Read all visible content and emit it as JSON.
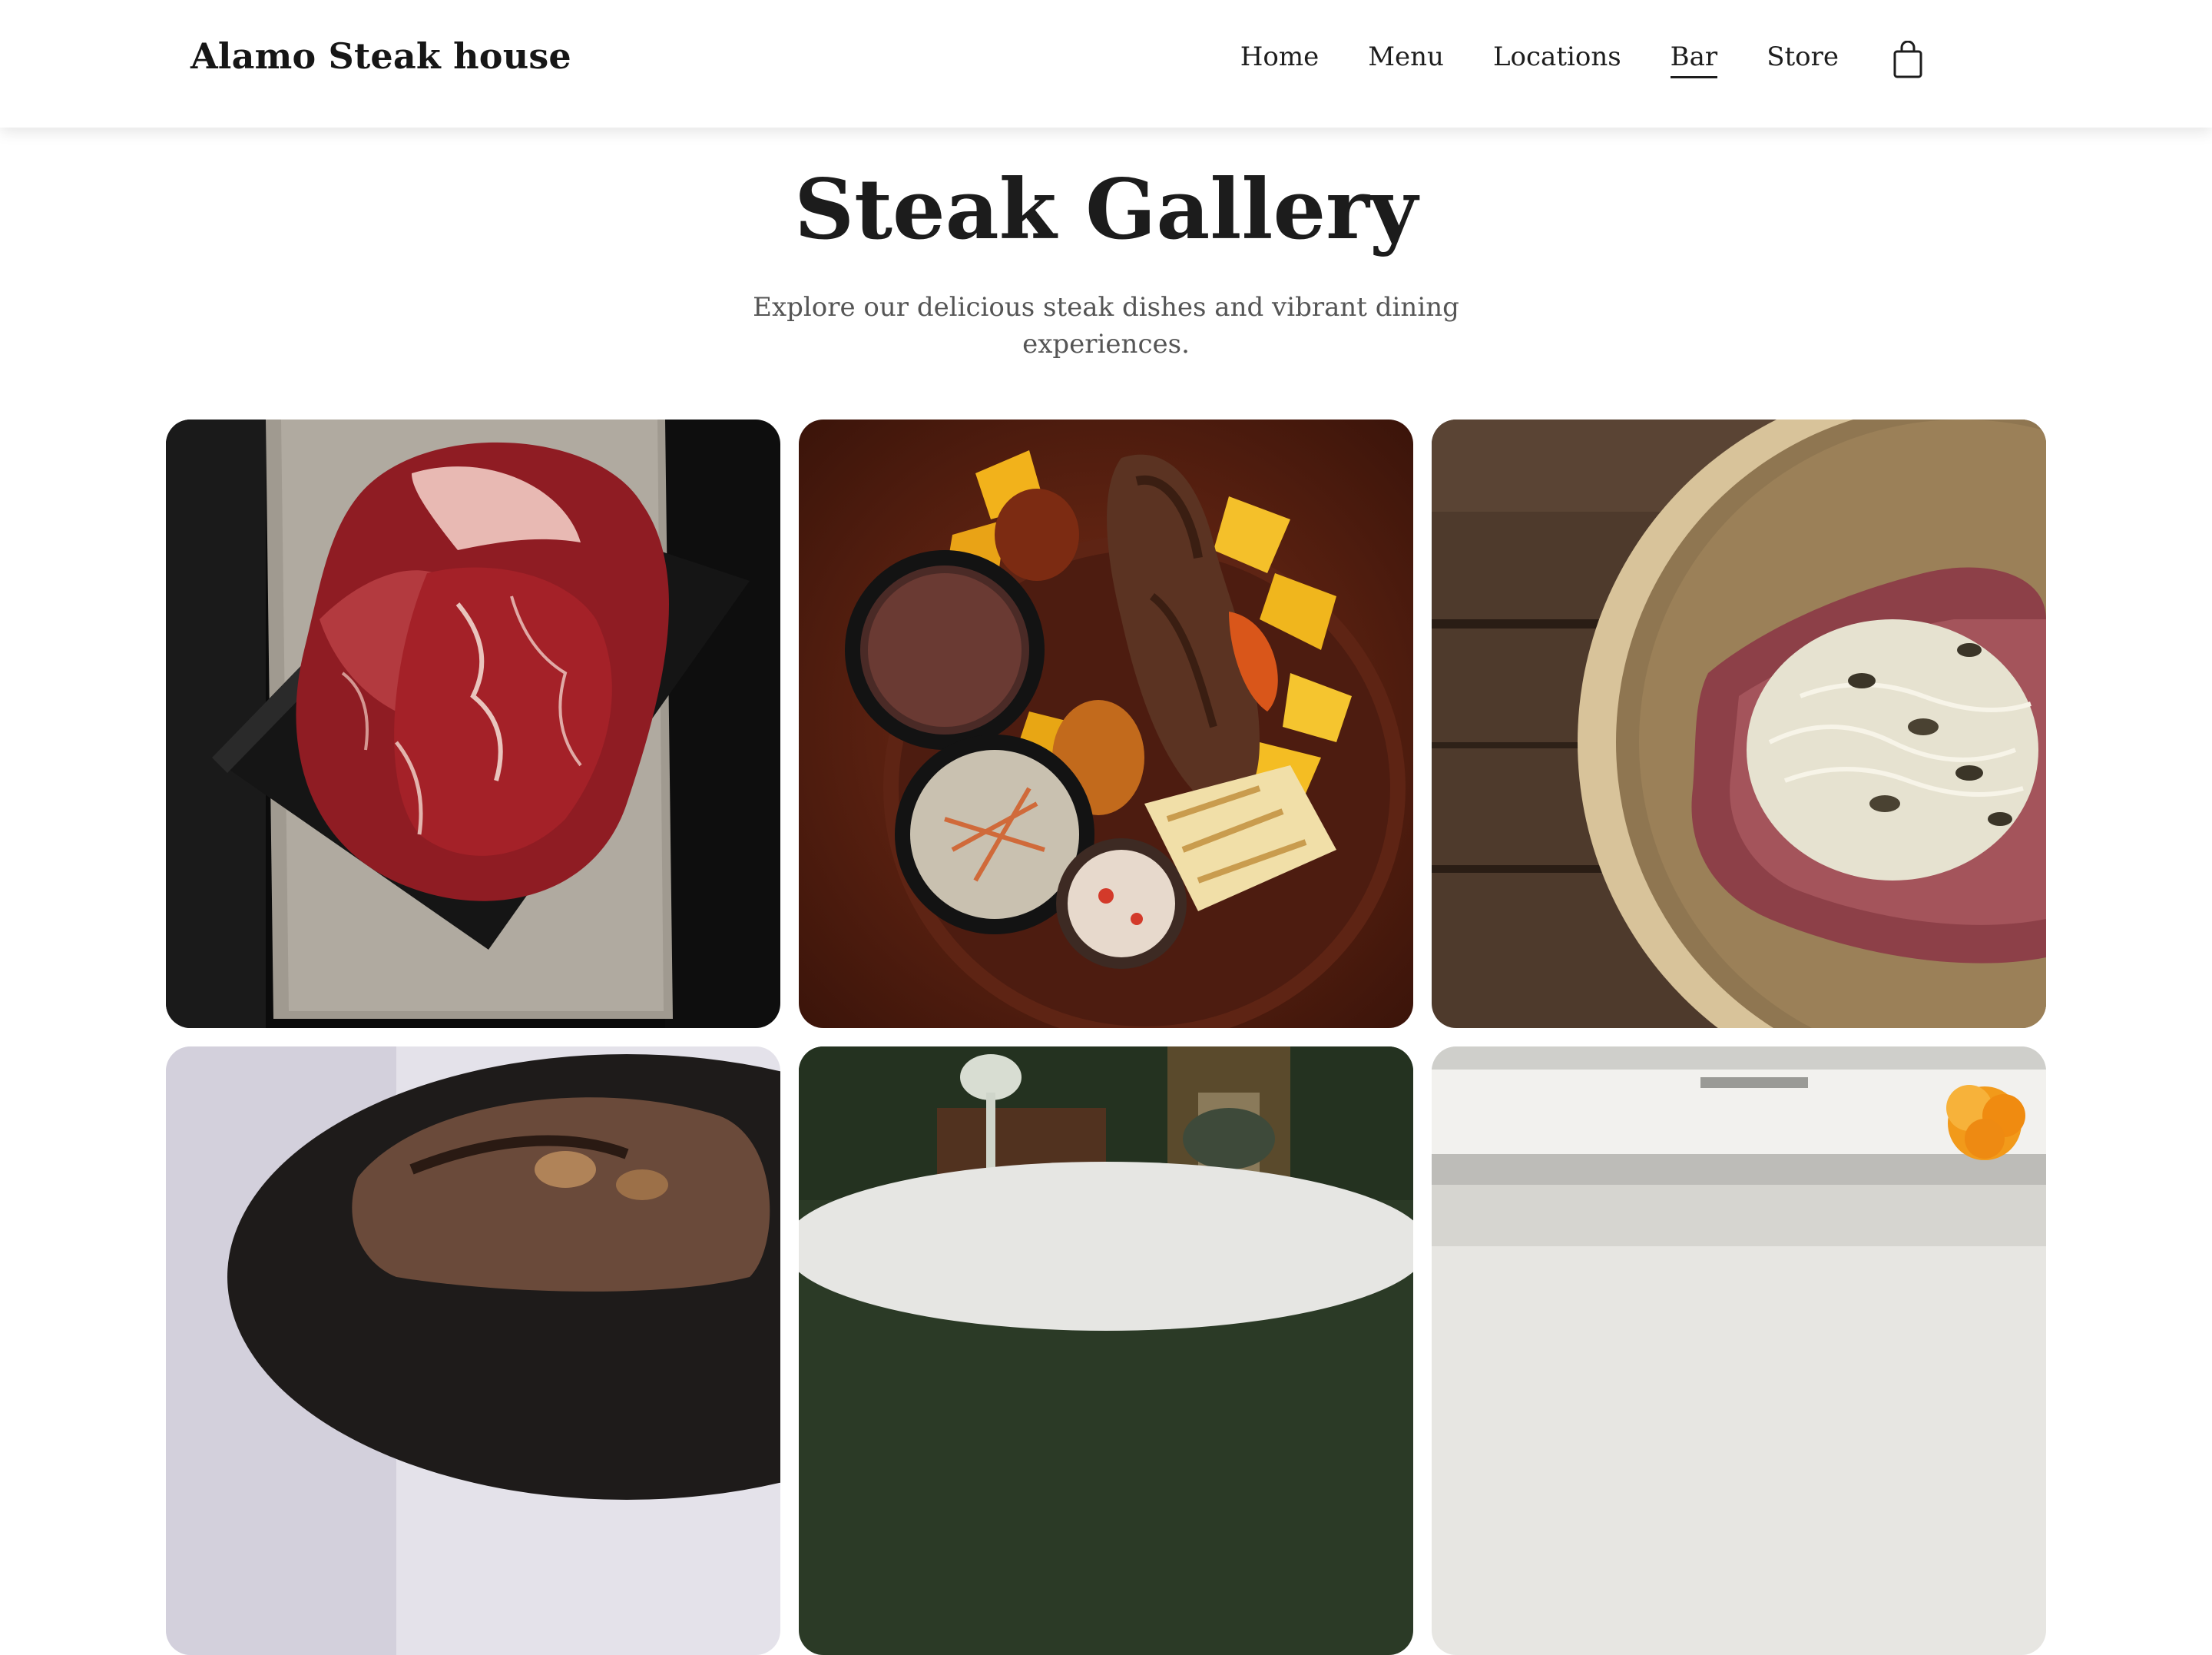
{
  "header": {
    "brand": "Alamo Steak house",
    "nav": [
      {
        "label": "Home",
        "active": false
      },
      {
        "label": "Menu",
        "active": false
      },
      {
        "label": "Locations",
        "active": false
      },
      {
        "label": "Bar",
        "active": true
      },
      {
        "label": "Store",
        "active": false
      }
    ],
    "cart_icon": "shopping-bag-icon"
  },
  "hero": {
    "title": "Steak Gallery",
    "subtitle": "Explore our delicious steak dishes and vibrant dining experiences."
  },
  "gallery": {
    "images": [
      {
        "subject": "raw-marbled-ribeye"
      },
      {
        "subject": "grilled-steak-platter"
      },
      {
        "subject": "sliced-beef-plate"
      },
      {
        "subject": "steak-in-cast-iron-pan"
      },
      {
        "subject": "dining-table-drinks"
      },
      {
        "subject": "table-with-flower"
      }
    ]
  },
  "colors": {
    "text_primary": "#1c1c1c",
    "text_muted": "#555555",
    "background": "#ffffff"
  }
}
